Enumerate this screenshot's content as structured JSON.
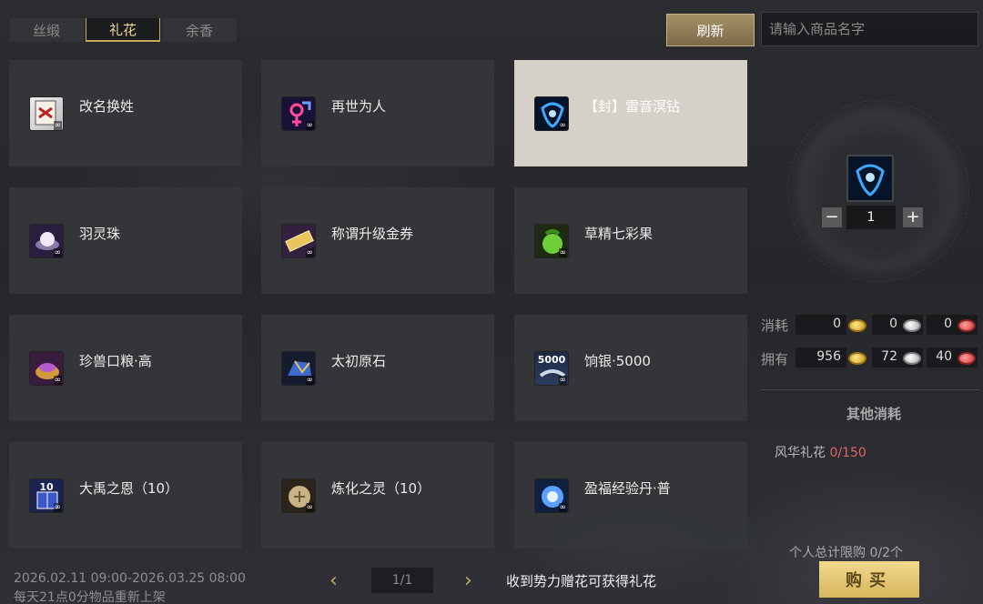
{
  "tabs": [
    {
      "label": "丝缎",
      "active": false
    },
    {
      "label": "礼花",
      "active": true
    },
    {
      "label": "余香",
      "active": false
    }
  ],
  "toolbar": {
    "refresh_label": "刷新",
    "search_placeholder": "请输入商品名字"
  },
  "items": [
    {
      "name": "改名换姓",
      "icon": "name-card-icon"
    },
    {
      "name": "再世为人",
      "icon": "gender-symbol-icon"
    },
    {
      "name": "【封】雷音溟钻",
      "icon": "blue-gem-icon",
      "selected": true
    },
    {
      "name": "羽灵珠",
      "icon": "pearl-icon"
    },
    {
      "name": "称谓升级金券",
      "icon": "gold-ticket-icon"
    },
    {
      "name": "草精七彩果",
      "icon": "green-fruit-icon"
    },
    {
      "name": "珍兽口粮·高",
      "icon": "pet-food-icon"
    },
    {
      "name": "太初原石",
      "icon": "ore-stone-icon"
    },
    {
      "name": "饷银·5000",
      "icon": "silver-5000-icon",
      "icon_text": "5000"
    },
    {
      "name": "大禹之恩（10）",
      "icon": "book-icon",
      "icon_text": "10"
    },
    {
      "name": "炼化之灵（10）",
      "icon": "spirit-orb-icon"
    },
    {
      "name": "盈福经验丹·普",
      "icon": "exp-pill-icon"
    }
  ],
  "infinite_mark": "∞",
  "detail": {
    "quantity": "1",
    "minus": "−",
    "plus": "+",
    "consume_label": "消耗",
    "own_label": "拥有",
    "consume": [
      "0",
      "0",
      "0"
    ],
    "own": [
      "956",
      "72",
      "40"
    ],
    "other_title": "其他消耗",
    "other_item_name": "风华礼花",
    "other_item_count": "0/150",
    "limit_text": "个人总计限购",
    "limit_value": "0/2个",
    "buy_label": "购买"
  },
  "footer": {
    "date_range": "2026.02.11 09:00-2026.03.25 08:00",
    "restock_note": "每天21点0分物品重新上架",
    "page": "1/1",
    "prev": "‹",
    "next": "›",
    "notice": "收到势力赠花可获得礼花"
  },
  "colors": {
    "accent_gold": "#c9a860",
    "buy_button": "#e4c775",
    "count_red": "#e0675f"
  }
}
